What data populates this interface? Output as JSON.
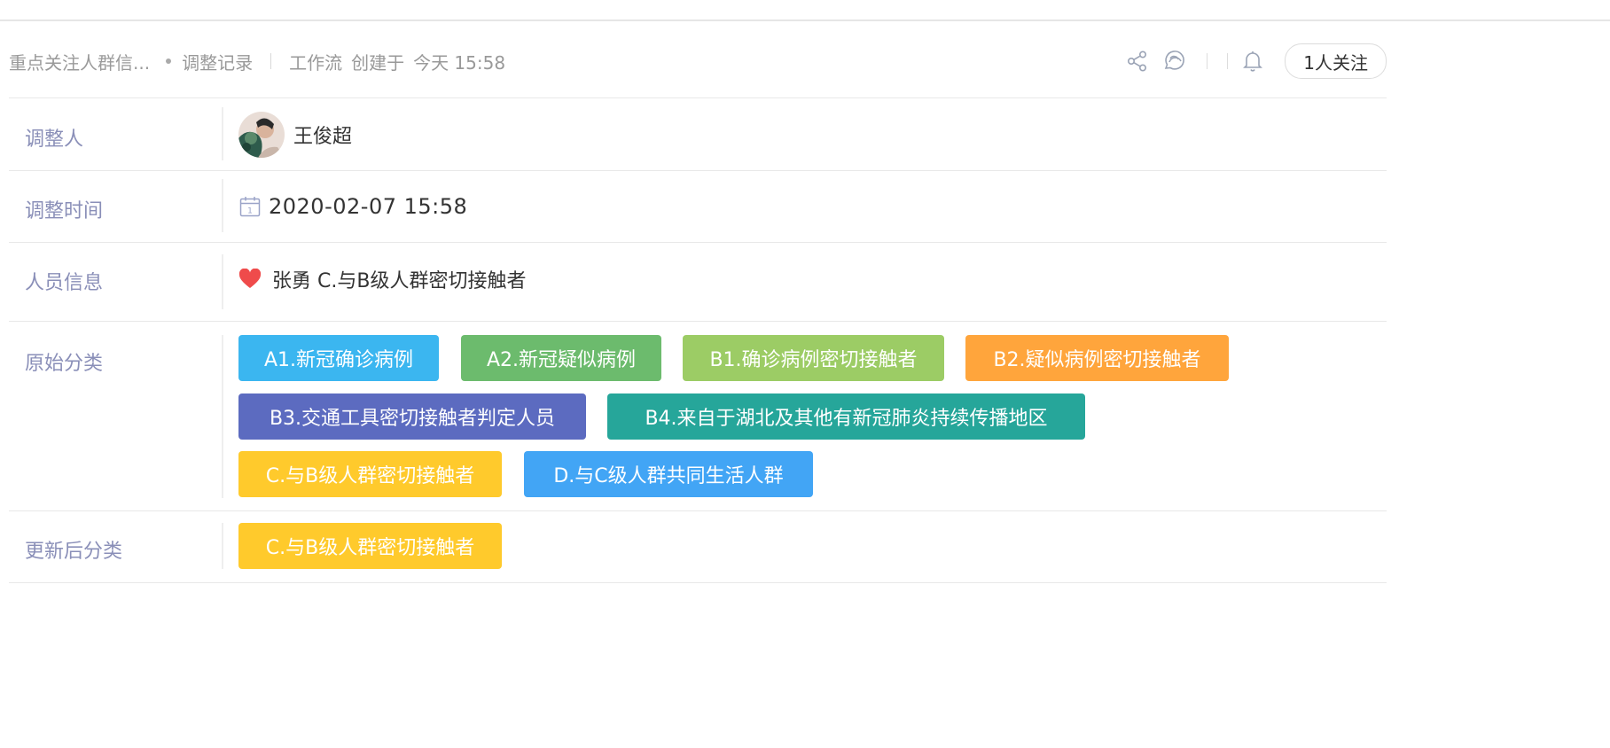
{
  "header": {
    "title": "重点关注人群信...",
    "record": "调整记录",
    "workflow": "工作流",
    "created_label": "创建于",
    "created_time": "今天 15:58",
    "follow_label": "1人关注",
    "icons": [
      "share-icon",
      "discussion-icon",
      "bell-icon"
    ]
  },
  "rows": {
    "adjuster": {
      "label": "调整人",
      "value": "王俊超"
    },
    "time": {
      "label": "调整时间",
      "value": "2020-02-07 15:58",
      "icon_day": "1"
    },
    "person": {
      "label": "人员信息",
      "value": "张勇 C.与B级人群密切接触者"
    },
    "original": {
      "label": "原始分类",
      "tags": [
        {
          "text": "A1.新冠确诊病例",
          "color": "#3bb6f0"
        },
        {
          "text": "A2.新冠疑似病例",
          "color": "#6cbb6d"
        },
        {
          "text": "B1.确诊病例密切接触者",
          "color": "#9ccc65"
        },
        {
          "text": "B2.疑似病例密切接触者",
          "color": "#ffa53c"
        },
        {
          "text": "B3.交通工具密切接触者判定人员",
          "color": "#5c6bc0"
        },
        {
          "text": "B4.来自于湖北及其他有新冠肺炎持续传播地区",
          "color": "#26a69a"
        },
        {
          "text": "C.与B级人群密切接触者",
          "color": "#ffca2c"
        },
        {
          "text": "D.与C级人群共同生活人群",
          "color": "#42a5f5"
        }
      ]
    },
    "updated": {
      "label": "更新后分类",
      "tags": [
        {
          "text": "C.与B级人群密切接触者",
          "color": "#ffca2c"
        }
      ]
    }
  },
  "colors": {
    "label": "#8a8fb8",
    "heart": "#ef4b4b"
  }
}
